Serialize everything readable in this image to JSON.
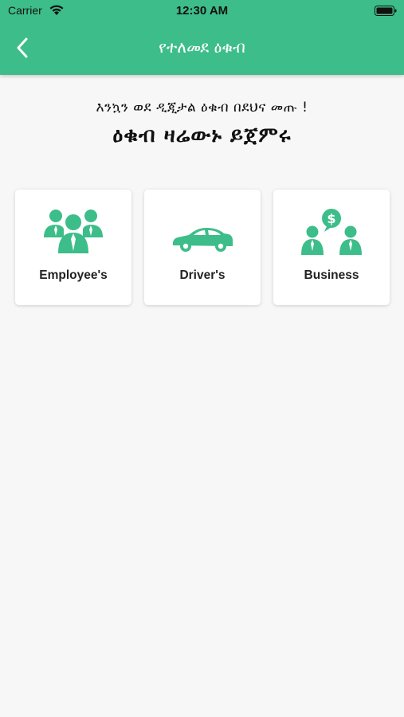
{
  "status_bar": {
    "carrier": "Carrier",
    "time": "12:30 AM"
  },
  "nav": {
    "title": "የተለመደ ዕቁብ"
  },
  "hero": {
    "subtitle": "እንኳን ወደ ዲጂታል ዕቁብ በደህና መጡ !",
    "title": "ዕቁብ ዛሬውኑ ይጀምሩ"
  },
  "cards": [
    {
      "label": "Employee's",
      "icon": "employees-group-icon"
    },
    {
      "label": "Driver's",
      "icon": "car-icon"
    },
    {
      "label": "Business",
      "icon": "business-people-money-icon"
    }
  ],
  "colors": {
    "accent": "#3dbd89",
    "background": "#f7f7f7"
  }
}
